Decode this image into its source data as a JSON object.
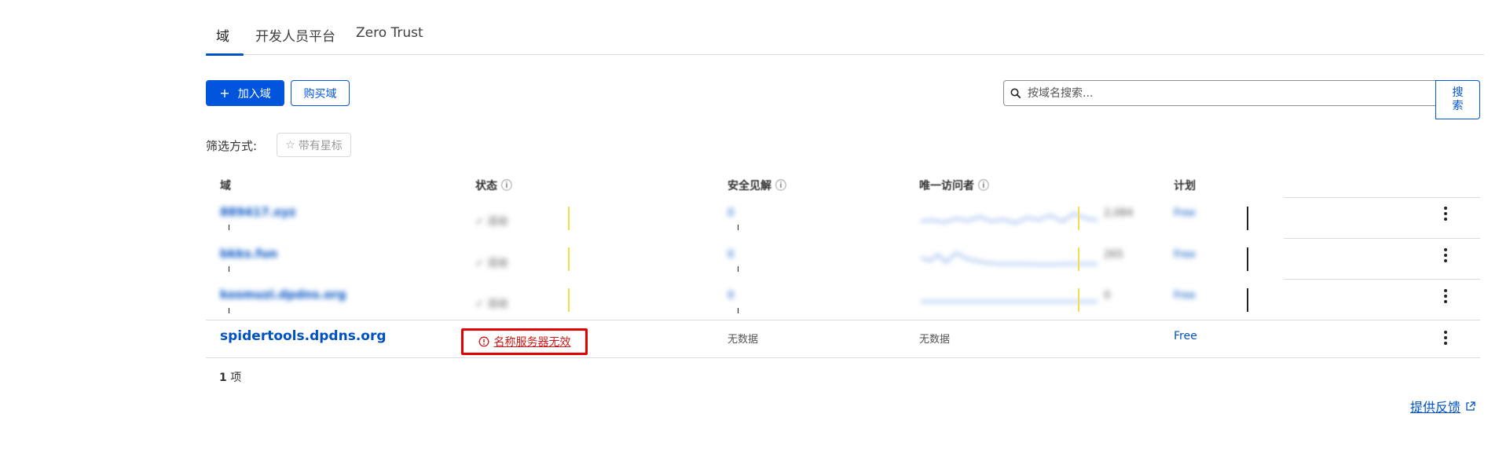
{
  "tabs": [
    {
      "label": "域",
      "active": true
    },
    {
      "label": "开发人员平台",
      "active": false
    },
    {
      "label": "Zero Trust",
      "active": false
    }
  ],
  "toolbar": {
    "add_domain_icon": "plus-icon",
    "add_domain_label": "加入域",
    "buy_domain_label": "购买域"
  },
  "search": {
    "placeholder": "按域名搜索...",
    "button_label": "搜索",
    "icon": "search-icon"
  },
  "filter": {
    "label": "筛选方式:",
    "starred_label": "带有星标",
    "starred_icon": "star-outline-icon"
  },
  "table": {
    "headers": [
      "域",
      "状态",
      "安全见解",
      "唯一访问者",
      "计划"
    ],
    "info_icon": "info-circle-icon",
    "blurred_rows": [
      {
        "domain": "889417.xyz",
        "status": "✓ 活动",
        "insights": "0",
        "visitors": "2,084",
        "plan": "Free"
      },
      {
        "domain": "bkks.fun",
        "status": "✓ 活动",
        "insights": "0",
        "visitors": "265",
        "plan": "Free"
      },
      {
        "domain": "kosmuzi.dpdns.org",
        "status": "✓ 活动",
        "insights": "0",
        "visitors": "0",
        "plan": "Free"
      }
    ],
    "main_row": {
      "domain": "spidertools.dpdns.org",
      "status_icon": "alert-circle-icon",
      "status": "名称服务器无效",
      "insights": "无数据",
      "visitors": "无数据",
      "plan": "Free",
      "menu_icon": "kebab-menu-icon"
    }
  },
  "footer": {
    "count_number": "1",
    "count_unit": "项",
    "feedback_label": "提供反馈",
    "feedback_icon": "external-link-icon"
  },
  "colors": {
    "accent": "#0055dc",
    "link": "#0051c3",
    "error": "#e30000"
  }
}
